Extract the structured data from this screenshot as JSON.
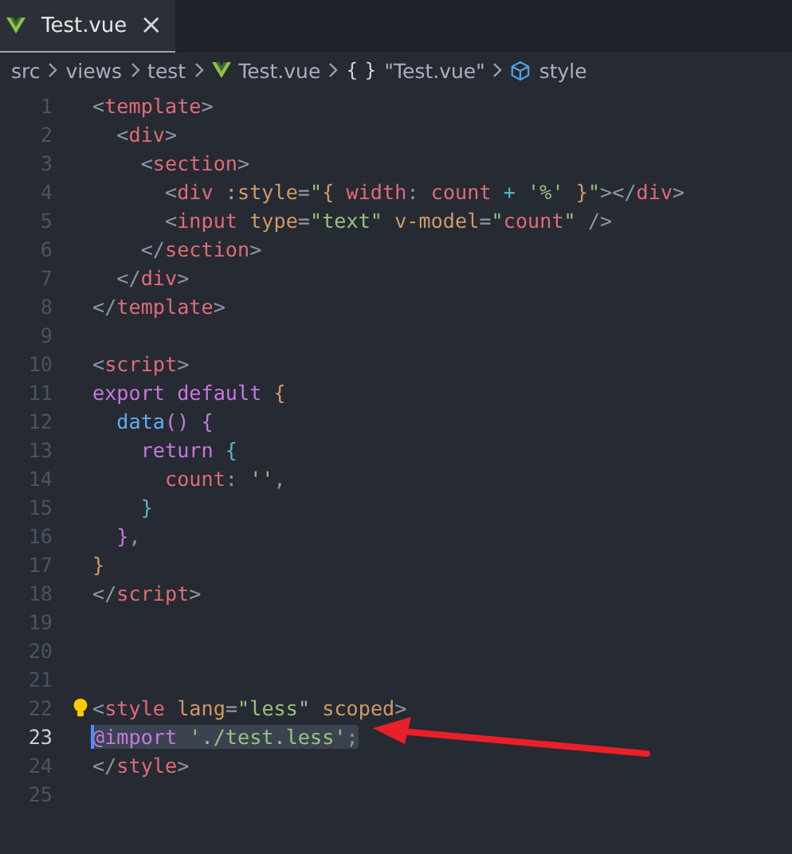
{
  "tabs": [
    {
      "label": "Test.vue",
      "kind": "file",
      "selected": true,
      "close": "×"
    }
  ],
  "breadcrumb": [
    {
      "text": "src",
      "kind": "folder"
    },
    {
      "text": "views",
      "kind": "folder"
    },
    {
      "text": "test",
      "kind": "folder"
    },
    {
      "text": "Test.vue",
      "kind": "file"
    },
    {
      "text": "\"Test.vue\"",
      "kind": "object",
      "glyph": "{ }"
    },
    {
      "text": "style",
      "kind": "element"
    }
  ],
  "lines": [
    {
      "number": "1",
      "tokens": [
        {
          "t": "<",
          "kind": "p"
        },
        {
          "t": "template",
          "kind": "tag"
        },
        {
          "t": ">",
          "kind": "p"
        }
      ],
      "children": [
        {
          "number": "2",
          "tokens": [
            {
              "t": "<",
              "kind": "p"
            },
            {
              "t": "div",
              "kind": "tag"
            },
            {
              "t": ">",
              "kind": "p"
            }
          ],
          "children": [
            {
              "number": "3",
              "tokens": [
                {
                  "t": "<",
                  "kind": "p"
                },
                {
                  "t": "section",
                  "kind": "tag"
                },
                {
                  "t": ">",
                  "kind": "p"
                }
              ],
              "children": [
                {
                  "number": "4",
                  "tokens": [
                    {
                      "t": "<",
                      "kind": "p"
                    },
                    {
                      "t": "div",
                      "kind": "tag"
                    },
                    {
                      "t": " :style",
                      "kind": "attr"
                    },
                    {
                      "t": "=",
                      "kind": "p"
                    },
                    {
                      "t": "\"",
                      "kind": "str"
                    },
                    {
                      "t": "{",
                      "kind": "attr"
                    },
                    {
                      "t": " width",
                      "kind": "tag"
                    },
                    {
                      "t": ": ",
                      "kind": "p"
                    },
                    {
                      "t": "count",
                      "kind": "tag"
                    },
                    {
                      "t": " + ",
                      "kind": "op"
                    },
                    {
                      "t": "'%'",
                      "kind": "str"
                    },
                    {
                      "t": " }",
                      "kind": "attr"
                    },
                    {
                      "t": "\"",
                      "kind": "str"
                    },
                    {
                      "t": "></",
                      "kind": "p"
                    },
                    {
                      "t": "div",
                      "kind": "tag"
                    },
                    {
                      "t": ">",
                      "kind": "p"
                    }
                  ]
                },
                {
                  "number": "5",
                  "tokens": [
                    {
                      "t": "<",
                      "kind": "p"
                    },
                    {
                      "t": "input",
                      "kind": "tag"
                    },
                    {
                      "t": " type",
                      "kind": "attr"
                    },
                    {
                      "t": "=",
                      "kind": "p"
                    },
                    {
                      "t": "\"text\"",
                      "kind": "str"
                    },
                    {
                      "t": " v-model",
                      "kind": "attr"
                    },
                    {
                      "t": "=",
                      "kind": "p"
                    },
                    {
                      "t": "\"",
                      "kind": "str"
                    },
                    {
                      "t": "count",
                      "kind": "tag"
                    },
                    {
                      "t": "\"",
                      "kind": "str"
                    },
                    {
                      "t": " />",
                      "kind": "p"
                    }
                  ]
                }
              ]
            },
            {
              "number": "6",
              "tokens": [
                {
                  "t": "</",
                  "kind": "p"
                },
                {
                  "t": "section",
                  "kind": "tag"
                },
                {
                  "t": ">",
                  "kind": "p"
                }
              ]
            }
          ]
        },
        {
          "number": "7",
          "tokens": [
            {
              "t": "</",
              "kind": "p"
            },
            {
              "t": "div",
              "kind": "tag"
            },
            {
              "t": ">",
              "kind": "p"
            }
          ]
        }
      ]
    },
    {
      "number": "8",
      "tokens": [
        {
          "t": "</",
          "kind": "p"
        },
        {
          "t": "template",
          "kind": "tag"
        },
        {
          "t": ">",
          "kind": "p"
        }
      ]
    },
    {
      "number": "9"
    },
    {
      "number": "10",
      "tokens": [
        {
          "t": "<",
          "kind": "p"
        },
        {
          "t": "script",
          "kind": "tag"
        },
        {
          "t": ">",
          "kind": "p"
        }
      ]
    },
    {
      "number": "11",
      "tokens": [
        {
          "t": "export default ",
          "kind": "kw"
        },
        {
          "t": "{",
          "kind": "attr"
        }
      ],
      "children": [
        {
          "number": "12",
          "tokens": [
            {
              "t": "data",
              "kind": "fn"
            },
            {
              "t": "() ",
              "kind": "kw"
            },
            {
              "t": "{",
              "kind": "kw"
            }
          ],
          "children": [
            {
              "number": "13",
              "tokens": [
                {
                  "t": "return ",
                  "kind": "kw"
                },
                {
                  "t": "{",
                  "kind": "op"
                }
              ],
              "children": [
                {
                  "number": "14",
                  "tokens": [
                    {
                      "t": "count",
                      "kind": "tag"
                    },
                    {
                      "t": ": ",
                      "kind": "p"
                    },
                    {
                      "t": "''",
                      "kind": "str"
                    },
                    {
                      "t": ",",
                      "kind": "p"
                    }
                  ]
                }
              ]
            },
            {
              "number": "15",
              "tokens": [
                {
                  "t": "}",
                  "kind": "op"
                }
              ]
            }
          ]
        },
        {
          "number": "16",
          "tokens": [
            {
              "t": "}",
              "kind": "kw"
            },
            {
              "t": ",",
              "kind": "p"
            }
          ]
        }
      ]
    },
    {
      "number": "17",
      "tokens": [
        {
          "t": "}",
          "kind": "attr"
        }
      ]
    },
    {
      "number": "18",
      "tokens": [
        {
          "t": "</",
          "kind": "p"
        },
        {
          "t": "script",
          "kind": "tag"
        },
        {
          "t": ">",
          "kind": "p"
        }
      ]
    },
    {
      "number": "19"
    },
    {
      "number": "20"
    },
    {
      "number": "21"
    },
    {
      "number": "22",
      "bulb": true,
      "tokens": [
        {
          "t": "<",
          "kind": "p"
        },
        {
          "t": "style",
          "kind": "tag"
        },
        {
          "t": " lang",
          "kind": "attr"
        },
        {
          "t": "=",
          "kind": "p"
        },
        {
          "t": "\"less\"",
          "kind": "str"
        },
        {
          "t": " scoped",
          "kind": "attr"
        },
        {
          "t": ">",
          "kind": "p"
        }
      ]
    },
    {
      "number": "23",
      "current": true,
      "selected": true,
      "arrow": true,
      "tokens": [
        {
          "t": "@import",
          "kind": "kw"
        },
        {
          "t": " './test.less'",
          "kind": "str"
        },
        {
          "t": ";",
          "kind": "p"
        }
      ]
    },
    {
      "number": "24",
      "tokens": [
        {
          "t": "</",
          "kind": "p"
        },
        {
          "t": "style",
          "kind": "tag"
        },
        {
          "t": ">",
          "kind": "p"
        }
      ]
    },
    {
      "number": "25"
    }
  ]
}
